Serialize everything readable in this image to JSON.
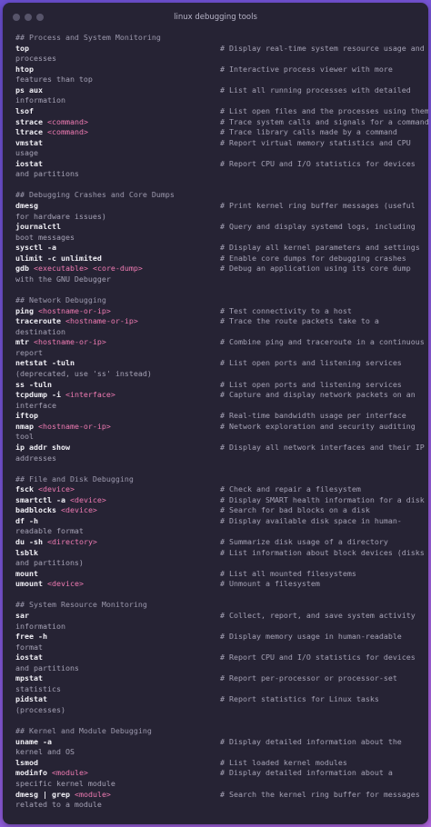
{
  "window": {
    "title": "linux debugging tools"
  },
  "sections": [
    {
      "heading": "## Process and System Monitoring",
      "items": [
        {
          "cmd": "top",
          "args": [],
          "comment": "# Display real-time system resource usage and",
          "cont": "processes"
        },
        {
          "cmd": "htop",
          "args": [],
          "comment": "# Interactive process viewer with more",
          "cont": "features than top"
        },
        {
          "cmd": "ps aux",
          "args": [],
          "comment": "# List all running processes with detailed",
          "cont": "information"
        },
        {
          "cmd": "lsof",
          "args": [],
          "comment": "# List open files and the processes using them",
          "cont": ""
        },
        {
          "cmd": "strace",
          "args": [
            "<command>"
          ],
          "comment": "# Trace system calls and signals for a command",
          "cont": ""
        },
        {
          "cmd": "ltrace",
          "args": [
            "<command>"
          ],
          "comment": "# Trace library calls made by a command",
          "cont": ""
        },
        {
          "cmd": "vmstat",
          "args": [],
          "comment": "# Report virtual memory statistics and CPU",
          "cont": "usage"
        },
        {
          "cmd": "iostat",
          "args": [],
          "comment": "# Report CPU and I/O statistics for devices",
          "cont": "and partitions"
        }
      ]
    },
    {
      "heading": "## Debugging Crashes and Core Dumps",
      "items": [
        {
          "cmd": "dmesg",
          "args": [],
          "comment": "# Print kernel ring buffer messages (useful",
          "cont": "for hardware issues)"
        },
        {
          "cmd": "journalctl",
          "args": [],
          "comment": "# Query and display systemd logs, including",
          "cont": "boot messages"
        },
        {
          "cmd": "sysctl -a",
          "args": [],
          "comment": "# Display all kernel parameters and settings",
          "cont": ""
        },
        {
          "cmd": "ulimit -c unlimited",
          "args": [],
          "comment": "# Enable core dumps for debugging crashes",
          "cont": ""
        },
        {
          "cmd": "gdb",
          "args": [
            "<executable>",
            "<core-dump>"
          ],
          "comment": "# Debug an application using its core dump",
          "cont": "with the GNU Debugger"
        }
      ]
    },
    {
      "heading": "## Network Debugging",
      "items": [
        {
          "cmd": "ping",
          "args": [
            "<hostname-or-ip>"
          ],
          "comment": "# Test connectivity to a host",
          "cont": ""
        },
        {
          "cmd": "traceroute",
          "args": [
            "<hostname-or-ip>"
          ],
          "comment": "# Trace the route packets take to a",
          "cont": "destination"
        },
        {
          "cmd": "mtr",
          "args": [
            "<hostname-or-ip>"
          ],
          "comment": "# Combine ping and traceroute in a continuous",
          "cont": "report"
        },
        {
          "cmd": "netstat -tuln",
          "args": [],
          "comment": "# List open ports and listening services",
          "cont": "(deprecated, use 'ss' instead)"
        },
        {
          "cmd": "ss -tuln",
          "args": [],
          "comment": "# List open ports and listening services",
          "cont": ""
        },
        {
          "cmd": "tcpdump -i",
          "args": [
            "<interface>"
          ],
          "comment": "# Capture and display network packets on an",
          "cont": "interface"
        },
        {
          "cmd": "iftop",
          "args": [],
          "comment": "# Real-time bandwidth usage per interface",
          "cont": ""
        },
        {
          "cmd": "nmap",
          "args": [
            "<hostname-or-ip>"
          ],
          "comment": "# Network exploration and security auditing",
          "cont": "tool"
        },
        {
          "cmd": "ip addr show",
          "args": [],
          "comment": "# Display all network interfaces and their IP",
          "cont": "addresses"
        }
      ]
    },
    {
      "heading": "## File and Disk Debugging",
      "items": [
        {
          "cmd": "fsck",
          "args": [
            "<device>"
          ],
          "comment": "# Check and repair a filesystem",
          "cont": ""
        },
        {
          "cmd": "smartctl -a",
          "args": [
            "<device>"
          ],
          "comment": "# Display SMART health information for a disk",
          "cont": ""
        },
        {
          "cmd": "badblocks",
          "args": [
            "<device>"
          ],
          "comment": "# Search for bad blocks on a disk",
          "cont": ""
        },
        {
          "cmd": "df -h",
          "args": [],
          "comment": "# Display available disk space in human-",
          "cont": "readable format"
        },
        {
          "cmd": "du -sh",
          "args": [
            "<directory>"
          ],
          "comment": "# Summarize disk usage of a directory",
          "cont": ""
        },
        {
          "cmd": "lsblk",
          "args": [],
          "comment": "# List information about block devices (disks",
          "cont": "and partitions)"
        },
        {
          "cmd": "mount",
          "args": [],
          "comment": "# List all mounted filesystems",
          "cont": ""
        },
        {
          "cmd": "umount",
          "args": [
            "<device>"
          ],
          "comment": "# Unmount a filesystem",
          "cont": ""
        }
      ]
    },
    {
      "heading": "## System Resource Monitoring",
      "items": [
        {
          "cmd": "sar",
          "args": [],
          "comment": "# Collect, report, and save system activity",
          "cont": "information"
        },
        {
          "cmd": "free -h",
          "args": [],
          "comment": "# Display memory usage in human-readable",
          "cont": "format"
        },
        {
          "cmd": "iostat",
          "args": [],
          "comment": "# Report CPU and I/O statistics for devices",
          "cont": "and partitions"
        },
        {
          "cmd": "mpstat",
          "args": [],
          "comment": "# Report per-processor or processor-set",
          "cont": "statistics"
        },
        {
          "cmd": "pidstat",
          "args": [],
          "comment": "# Report statistics for Linux tasks",
          "cont": "(processes)"
        }
      ]
    },
    {
      "heading": "## Kernel and Module Debugging",
      "items": [
        {
          "cmd": "uname -a",
          "args": [],
          "comment": "# Display detailed information about the",
          "cont": "kernel and OS"
        },
        {
          "cmd": "lsmod",
          "args": [],
          "comment": "# List loaded kernel modules",
          "cont": ""
        },
        {
          "cmd": "modinfo",
          "args": [
            "<module>"
          ],
          "comment": "# Display detailed information about a",
          "cont": "specific kernel module"
        },
        {
          "cmd": "dmesg",
          "args": [
            "|",
            "grep",
            "<module>"
          ],
          "comment": "# Search the kernel ring buffer for messages",
          "cont": "related to a module"
        }
      ]
    }
  ]
}
